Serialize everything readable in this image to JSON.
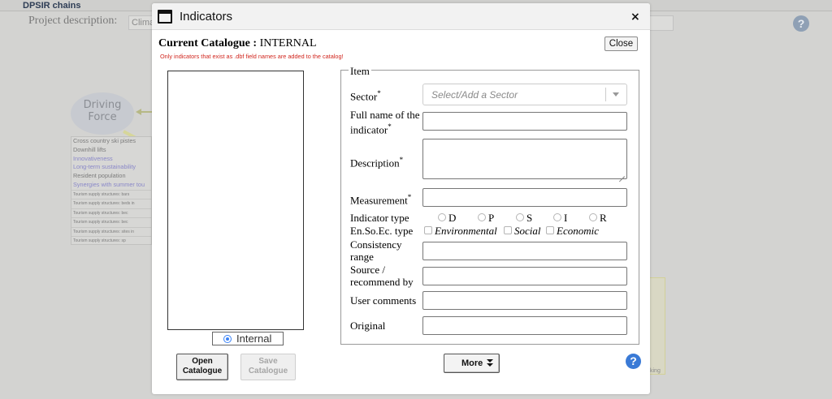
{
  "background": {
    "app_title": "DPSIR chains",
    "project_description_label": "Project description:",
    "project_description_value": "Clima",
    "help_icon": "?",
    "driving_force_label": "Driving Force",
    "indicator_list": [
      {
        "text": "Cross country ski pistes",
        "style": "normal"
      },
      {
        "text": "Downhill lifts",
        "style": "normal"
      },
      {
        "text": "Innovativeness",
        "style": "blue"
      },
      {
        "text": "Long-term sustainability",
        "style": "blue"
      },
      {
        "text": "Resident population",
        "style": "normal"
      },
      {
        "text": "Synergies with summer tou",
        "style": "blue"
      },
      {
        "text": "Tourism supply structures: bars",
        "style": "tiny"
      },
      {
        "text": "Tourism supply structures: beds in ",
        "style": "tiny"
      },
      {
        "text": "Tourism supply structures: bec",
        "style": "tiny"
      },
      {
        "text": "Tourism supply structures: bec",
        "style": "tiny"
      },
      {
        "text": "Tourism supply structures: sites in ",
        "style": "tiny"
      },
      {
        "text": "Tourism supply structures: sp",
        "style": "tiny"
      }
    ],
    "right_edge_text": "king"
  },
  "modal": {
    "title": "Indicators",
    "window_icon": "window-icon",
    "close_x": "×",
    "catalogue_label": "Current Catalogue :",
    "catalogue_value": "INTERNAL",
    "note": "Only indicators that exist as .dbf field names are added to the catalog!",
    "close_button": "Close",
    "catalogue_option": "Internal",
    "open_catalogue_button": [
      "Open",
      "Catalogue"
    ],
    "save_catalogue_button": [
      "Save",
      "Catalogue"
    ],
    "more_button": "More",
    "help_button": "?",
    "item": {
      "legend": "Item",
      "sector_label": "Sector",
      "sector_placeholder": "Select/Add a Sector",
      "full_name_label": [
        "Full name of the",
        "indicator"
      ],
      "description_label": "Description",
      "measurement_label": "Measurement",
      "indicator_type_label": "Indicator type",
      "indicator_types": [
        "D",
        "P",
        "S",
        "I",
        "R"
      ],
      "ensoec_label": "En.So.Ec. type",
      "ensoec_types": [
        "Environmental",
        "Social",
        "Economic"
      ],
      "consistency_label": [
        "Consistency",
        "range"
      ],
      "source_label": [
        "Source /",
        "recommend by"
      ],
      "user_comments_label": "User comments",
      "original_label": "Original",
      "required_mark": "*"
    }
  }
}
